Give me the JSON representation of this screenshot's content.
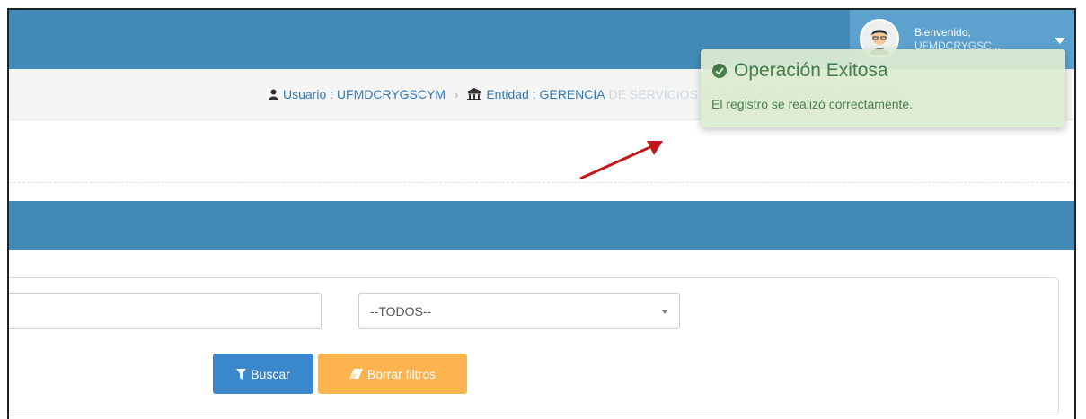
{
  "header": {
    "welcome_text": "Bienvenido,",
    "username_short": "UFMDCRYGSC..."
  },
  "breadcrumb": {
    "usuario": "Usuario : UFMDCRYGSCYM",
    "entidad_label": "Entidad : GERENCIA",
    "entidad_overflow": "DE SERVICIOS A LA CIUDAD Y MEDIO AMBIENTE"
  },
  "filters": {
    "select_value": "--TODOS--",
    "search_button": "Buscar",
    "clear_button": "Borrar filtros"
  },
  "toast": {
    "title": "Operación Exitosa",
    "message": "El registro se realizó correctamente."
  },
  "colors": {
    "header_bg": "#428bb8",
    "success_bg": "#dcecd1",
    "success_text": "#3c763d",
    "primary_btn": "#3a87cc",
    "warning_btn": "#fbb450",
    "annotation_arrow": "#c0181c"
  },
  "icons": [
    "user-icon",
    "bank-icon",
    "filter-icon",
    "eraser-icon",
    "check-circle-icon",
    "chevron-down-icon"
  ]
}
